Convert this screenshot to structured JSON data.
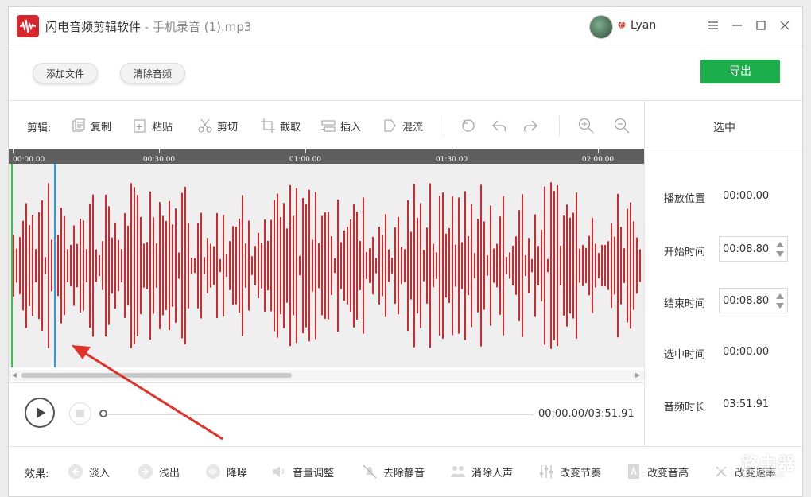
{
  "window": {
    "app_name": "闪电音频剪辑软件",
    "separator": " - ",
    "file_name": "手机录音 (1).mp3",
    "user_name": "Lyan"
  },
  "toolbar": {
    "add_file": "添加文件",
    "clear_audio": "清除音频",
    "export": "导出"
  },
  "edit_toolbar": {
    "label": "剪辑:",
    "copy": "复制",
    "paste": "粘贴",
    "cut": "剪切",
    "crop": "截取",
    "insert": "插入",
    "mix": "混流"
  },
  "timeline": {
    "ticks": [
      "00:00.00",
      "00:30.00",
      "01:00.00",
      "01:30.00",
      "02:00.00"
    ]
  },
  "player": {
    "time": "00:00.00/03:51.91"
  },
  "panel": {
    "header": "选中",
    "play_position_label": "播放位置",
    "play_position_value": "00:00.00",
    "start_time_label": "开始时间",
    "start_time_value": "00:08.80",
    "end_time_label": "结束时间",
    "end_time_value": "00:08.80",
    "selected_time_label": "选中时间",
    "selected_time_value": "00:00.00",
    "duration_label": "音频时长",
    "duration_value": "03:51.91"
  },
  "effects": {
    "label": "效果:",
    "fade_in": "淡入",
    "fade_out": "浅出",
    "denoise": "降噪",
    "volume": "音量调整",
    "remove_silence": "去除静音",
    "remove_vocals": "消除人声",
    "tempo": "改变节奏",
    "pitch": "改变音高",
    "rate": "改变速率"
  },
  "watermark": {
    "text": "路由器",
    "sub": "luyouqi.com"
  },
  "colors": {
    "waveform": "#d0282d",
    "export_button": "#1aad4a",
    "playhead": "#2a9be0",
    "start_marker": "#35c24a",
    "annotation_arrow": "#e0312b"
  }
}
